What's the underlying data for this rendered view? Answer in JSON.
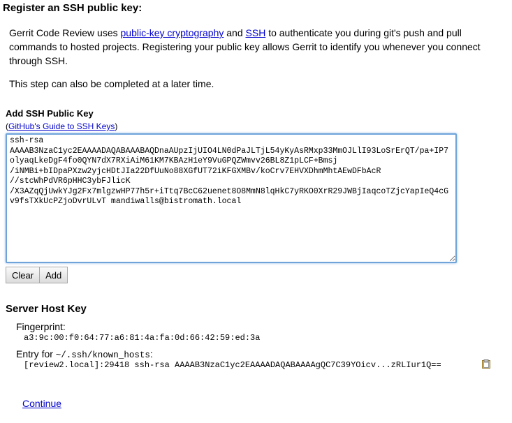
{
  "page": {
    "title": "Register an SSH public key:",
    "intro": {
      "text_before": "Gerrit Code Review uses ",
      "link1": "public-key cryptography",
      "text_mid": " and ",
      "link2": "SSH",
      "text_after": " to authenticate you during git's push and pull commands to hosted projects. Registering your public key allows Gerrit to identify you whenever you connect through SSH."
    },
    "later_note": "This step can also be completed at a later time."
  },
  "add_key": {
    "heading": "Add SSH Public Key",
    "guide_open": "(",
    "guide_link": "GitHub's Guide to SSH Keys",
    "guide_close": ")",
    "key_value": "ssh-rsa\nAAAAB3NzaC1yc2EAAAADAQABAAABAQDnaAUpzIjUIO4LN0dPaJLTjL54yKyAsRMxp33MmOJLlI93LoSrErQT/pa+IP7olyaqLkeDgF4fo0QYN7dX7RXiAiM61KM7KBAzH1eY9VuGPQZWmvv26BL8Z1pLCF+Bmsj\n/iNMBi+bIDpaPXzw2yjcHDtJIa22DfUuNo88XGfUT72iKFGXMBv/koCrv7EHVXDhmMhtAEwDFbAcR\n//stcWhPdVR6pHHC3ybFJlicK\n/X3AZqQjUwkYJg2Fx7mlgzwHP77h5r+iTtq7BcC62uenet8O8MmN8lqHkC7yRKO0XrR29JWBjIaqcoTZjcYapIeQ4cGv9fsTXkUcPZjoDvrULvT mandiwalls@bistromath.local",
    "clear_label": "Clear",
    "add_label": "Add"
  },
  "server_host_key": {
    "heading": "Server Host Key",
    "fingerprint_label": "Fingerprint:",
    "fingerprint_value": "a3:9c:00:f0:64:77:a6:81:4a:fa:0d:66:42:59:ed:3a",
    "entry_label_prefix": "Entry for ",
    "entry_label_path": "~/.ssh/known_hosts",
    "entry_label_suffix": ":",
    "entry_value": "[review2.local]:29418 ssh-rsa AAAAB3NzaC1yc2EAAAADAQABAAAAgQC7C39YOicv...zRLIur1Q=="
  },
  "continue_label": "Continue",
  "colors": {
    "link": "#0000cc",
    "focus_border": "#6fa3da"
  }
}
